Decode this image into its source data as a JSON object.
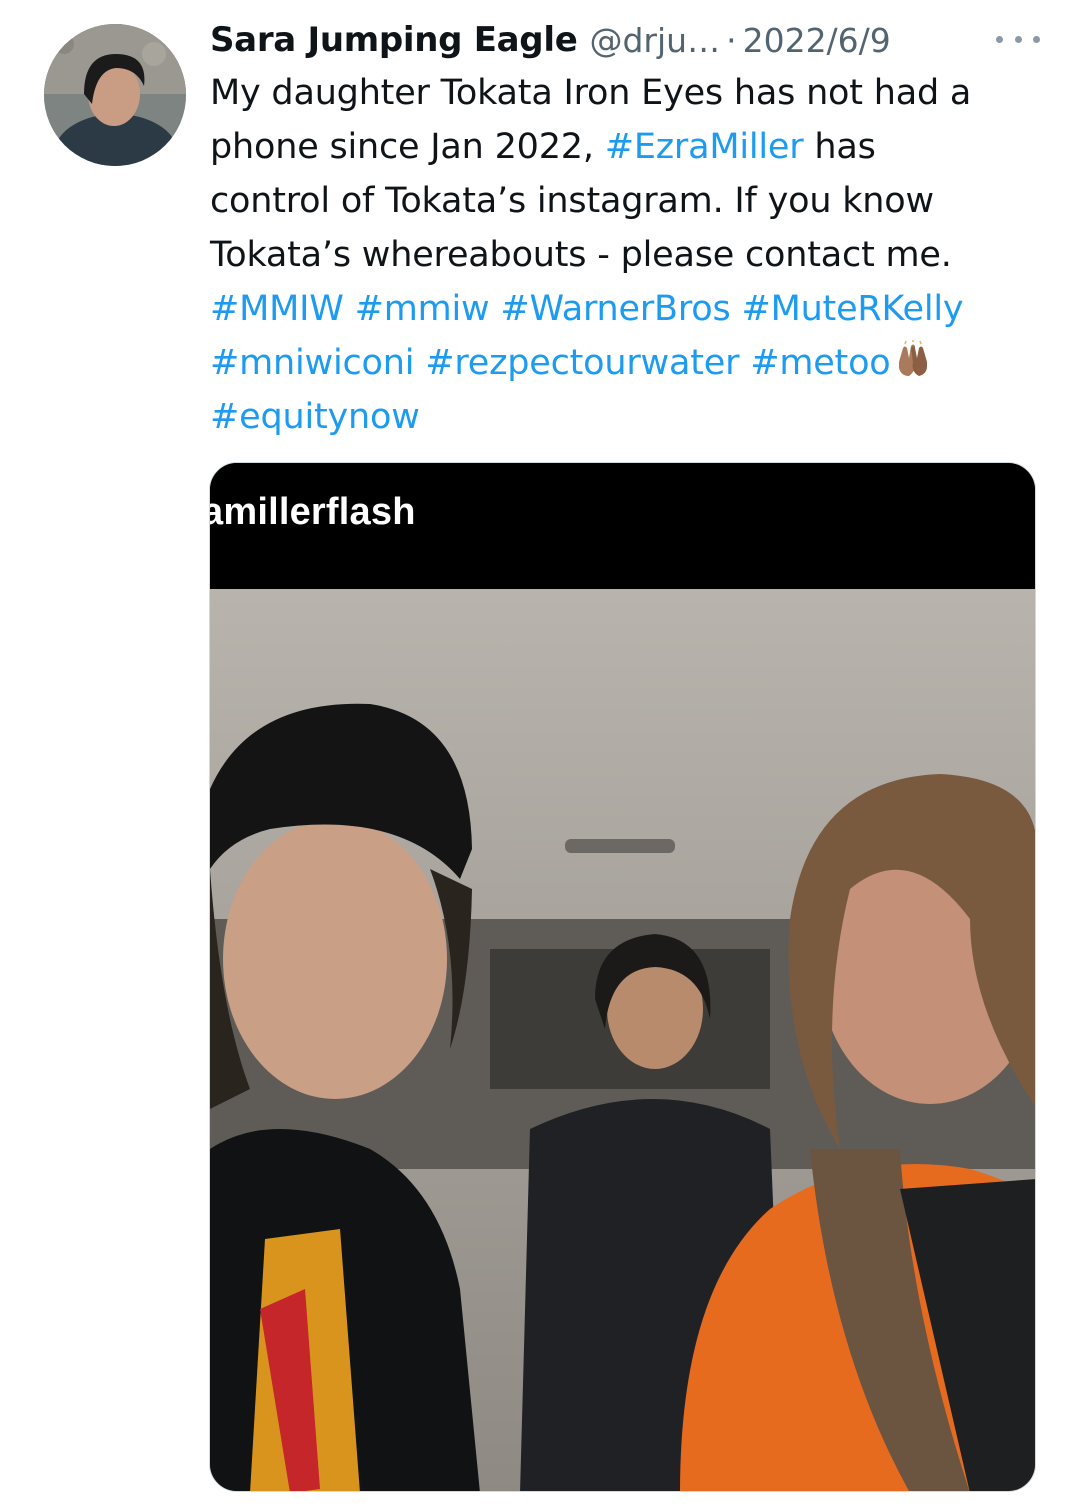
{
  "author": {
    "display_name": "Sara Jumping Eagle",
    "handle": "@drju…",
    "separator": "·",
    "timestamp": "2022/6/9"
  },
  "tweet": {
    "line1": "My daughter Tokata Iron Eyes has not had a",
    "line2_before": "phone since Jan 2022, ",
    "line2_hashtag": "#EzraMiller",
    "line2_after": " has",
    "line3": "control of Tokata’s instagram. If you know",
    "line4": "Tokata’s whereabouts - please contact me.",
    "hashtags_row1": [
      "#MMIW",
      "#mmiw",
      "#WarnerBros",
      "#MuteRKelly"
    ],
    "hashtags_row2": [
      "#mniwiconi",
      "#rezpectourwater",
      "#metoo"
    ],
    "hashtags_row3": [
      "#equitynow"
    ],
    "emoji": "raised-hands"
  },
  "media": {
    "overlay_username": "amillerflash"
  },
  "colors": {
    "hashtag": "#1d9bf0",
    "secondary_text": "#536471",
    "primary_text": "#0f1419"
  },
  "icons": {
    "more": "more-horizontal-icon",
    "emoji": "raised-hands-icon"
  }
}
